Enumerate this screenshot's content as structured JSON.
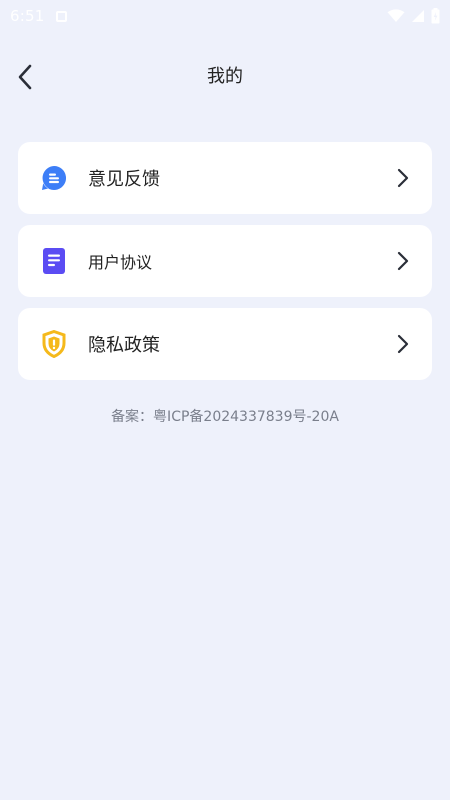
{
  "status_bar": {
    "time": "6:51"
  },
  "header": {
    "title": "我的"
  },
  "menu": {
    "items": [
      {
        "label": "意见反馈",
        "icon": "feedback-icon",
        "color": "#3d7ef7"
      },
      {
        "label": "用户协议",
        "icon": "document-icon",
        "color": "#5b4cf3"
      },
      {
        "label": "隐私政策",
        "icon": "shield-icon",
        "color": "#f5b91b"
      }
    ]
  },
  "footer": {
    "icp": "备案：粤ICP备2024337839号-20A"
  },
  "colors": {
    "background": "#eef1fb",
    "card": "#ffffff"
  }
}
